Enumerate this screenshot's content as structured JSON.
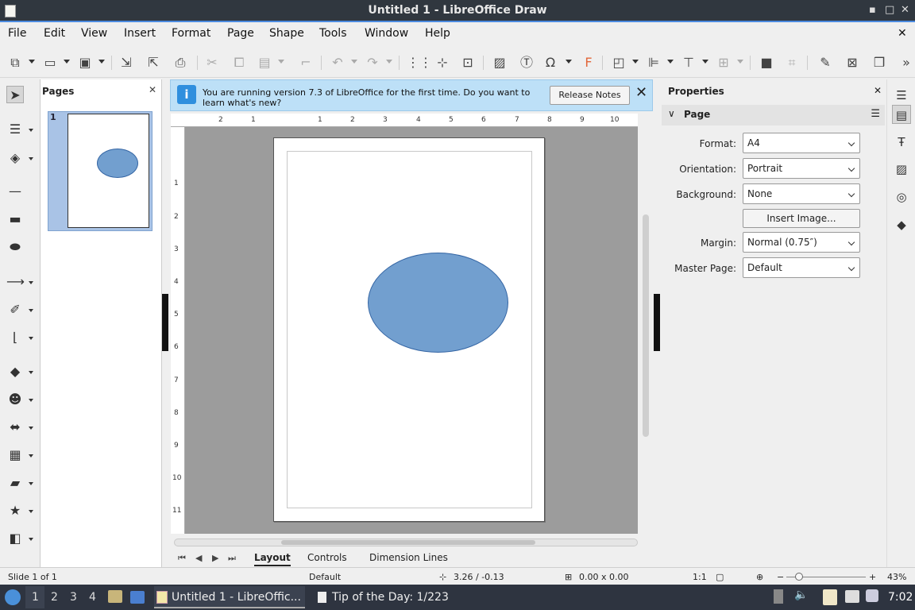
{
  "window": {
    "title": "Untitled 1 - LibreOffice Draw",
    "minimize": "▪",
    "maximize": "□",
    "close": "✕"
  },
  "menubar": {
    "items": [
      "File",
      "Edit",
      "View",
      "Insert",
      "Format",
      "Page",
      "Shape",
      "Tools",
      "Window",
      "Help"
    ],
    "close": "✕"
  },
  "toolbar": {
    "icons": [
      "new-icon",
      "open-icon",
      "save-icon",
      "export-icon",
      "export-pdf-icon",
      "print-icon",
      "cut-icon",
      "copy-icon",
      "paste-icon",
      "clone-formatting-icon",
      "undo-icon",
      "redo-icon",
      "grid-icon",
      "helplines-icon",
      "zoom-pan-icon",
      "image-icon",
      "textbox-icon",
      "special-character-icon",
      "fontwork-icon",
      "transformations-icon",
      "align-icon",
      "arrange-icon",
      "distribute-icon",
      "shadow-icon",
      "crop-icon",
      "points-icon",
      "glue-icon",
      "toggle-extrusion-icon",
      "more-icon"
    ]
  },
  "pages_panel": {
    "title": "Pages",
    "close": "✕",
    "thumb_number": "1"
  },
  "infobar": {
    "message": "You are running version 7.3 of LibreOffice for the first time. Do you want to learn what's new?",
    "button": "Release Notes",
    "close": "✕",
    "icon_text": "i"
  },
  "rulers": {
    "h_ticks": [
      "2",
      "1",
      "1",
      "2",
      "3",
      "4",
      "5",
      "6",
      "7",
      "8",
      "9",
      "10"
    ],
    "v_ticks": [
      "1",
      "2",
      "3",
      "4",
      "5",
      "6",
      "7",
      "8",
      "9",
      "10",
      "11"
    ]
  },
  "layer_tabs": {
    "items": [
      "Layout",
      "Controls",
      "Dimension Lines"
    ],
    "active": "Layout"
  },
  "properties": {
    "title": "Properties",
    "close": "✕",
    "section": "Page",
    "format_label": "Format:",
    "format_value": "A4",
    "orientation_label": "Orientation:",
    "orientation_value": "Portrait",
    "background_label": "Background:",
    "background_value": "None",
    "insert_image": "Insert Image...",
    "margin_label": "Margin:",
    "margin_value": "Normal (0.75″)",
    "master_label": "Master Page:",
    "master_value": "Default"
  },
  "statusbar": {
    "slide": "Slide 1 of 1",
    "layout": "Default",
    "position": "3.26 / -0.13",
    "size": "0.00 x 0.00",
    "scale": "1:1",
    "zoom": "43%",
    "zoom_level": 0.43
  },
  "taskbar": {
    "workspaces": [
      "1",
      "2",
      "3",
      "4"
    ],
    "apps": [
      "Untitled 1 - LibreOffic...",
      "Tip of the Day: 1/223"
    ],
    "clock": "7:02"
  },
  "colors": {
    "shape_fill": "#729fcf",
    "shape_stroke": "#3465a4",
    "infobar_bg": "#bde0f7",
    "accent": "#4b8be0"
  }
}
